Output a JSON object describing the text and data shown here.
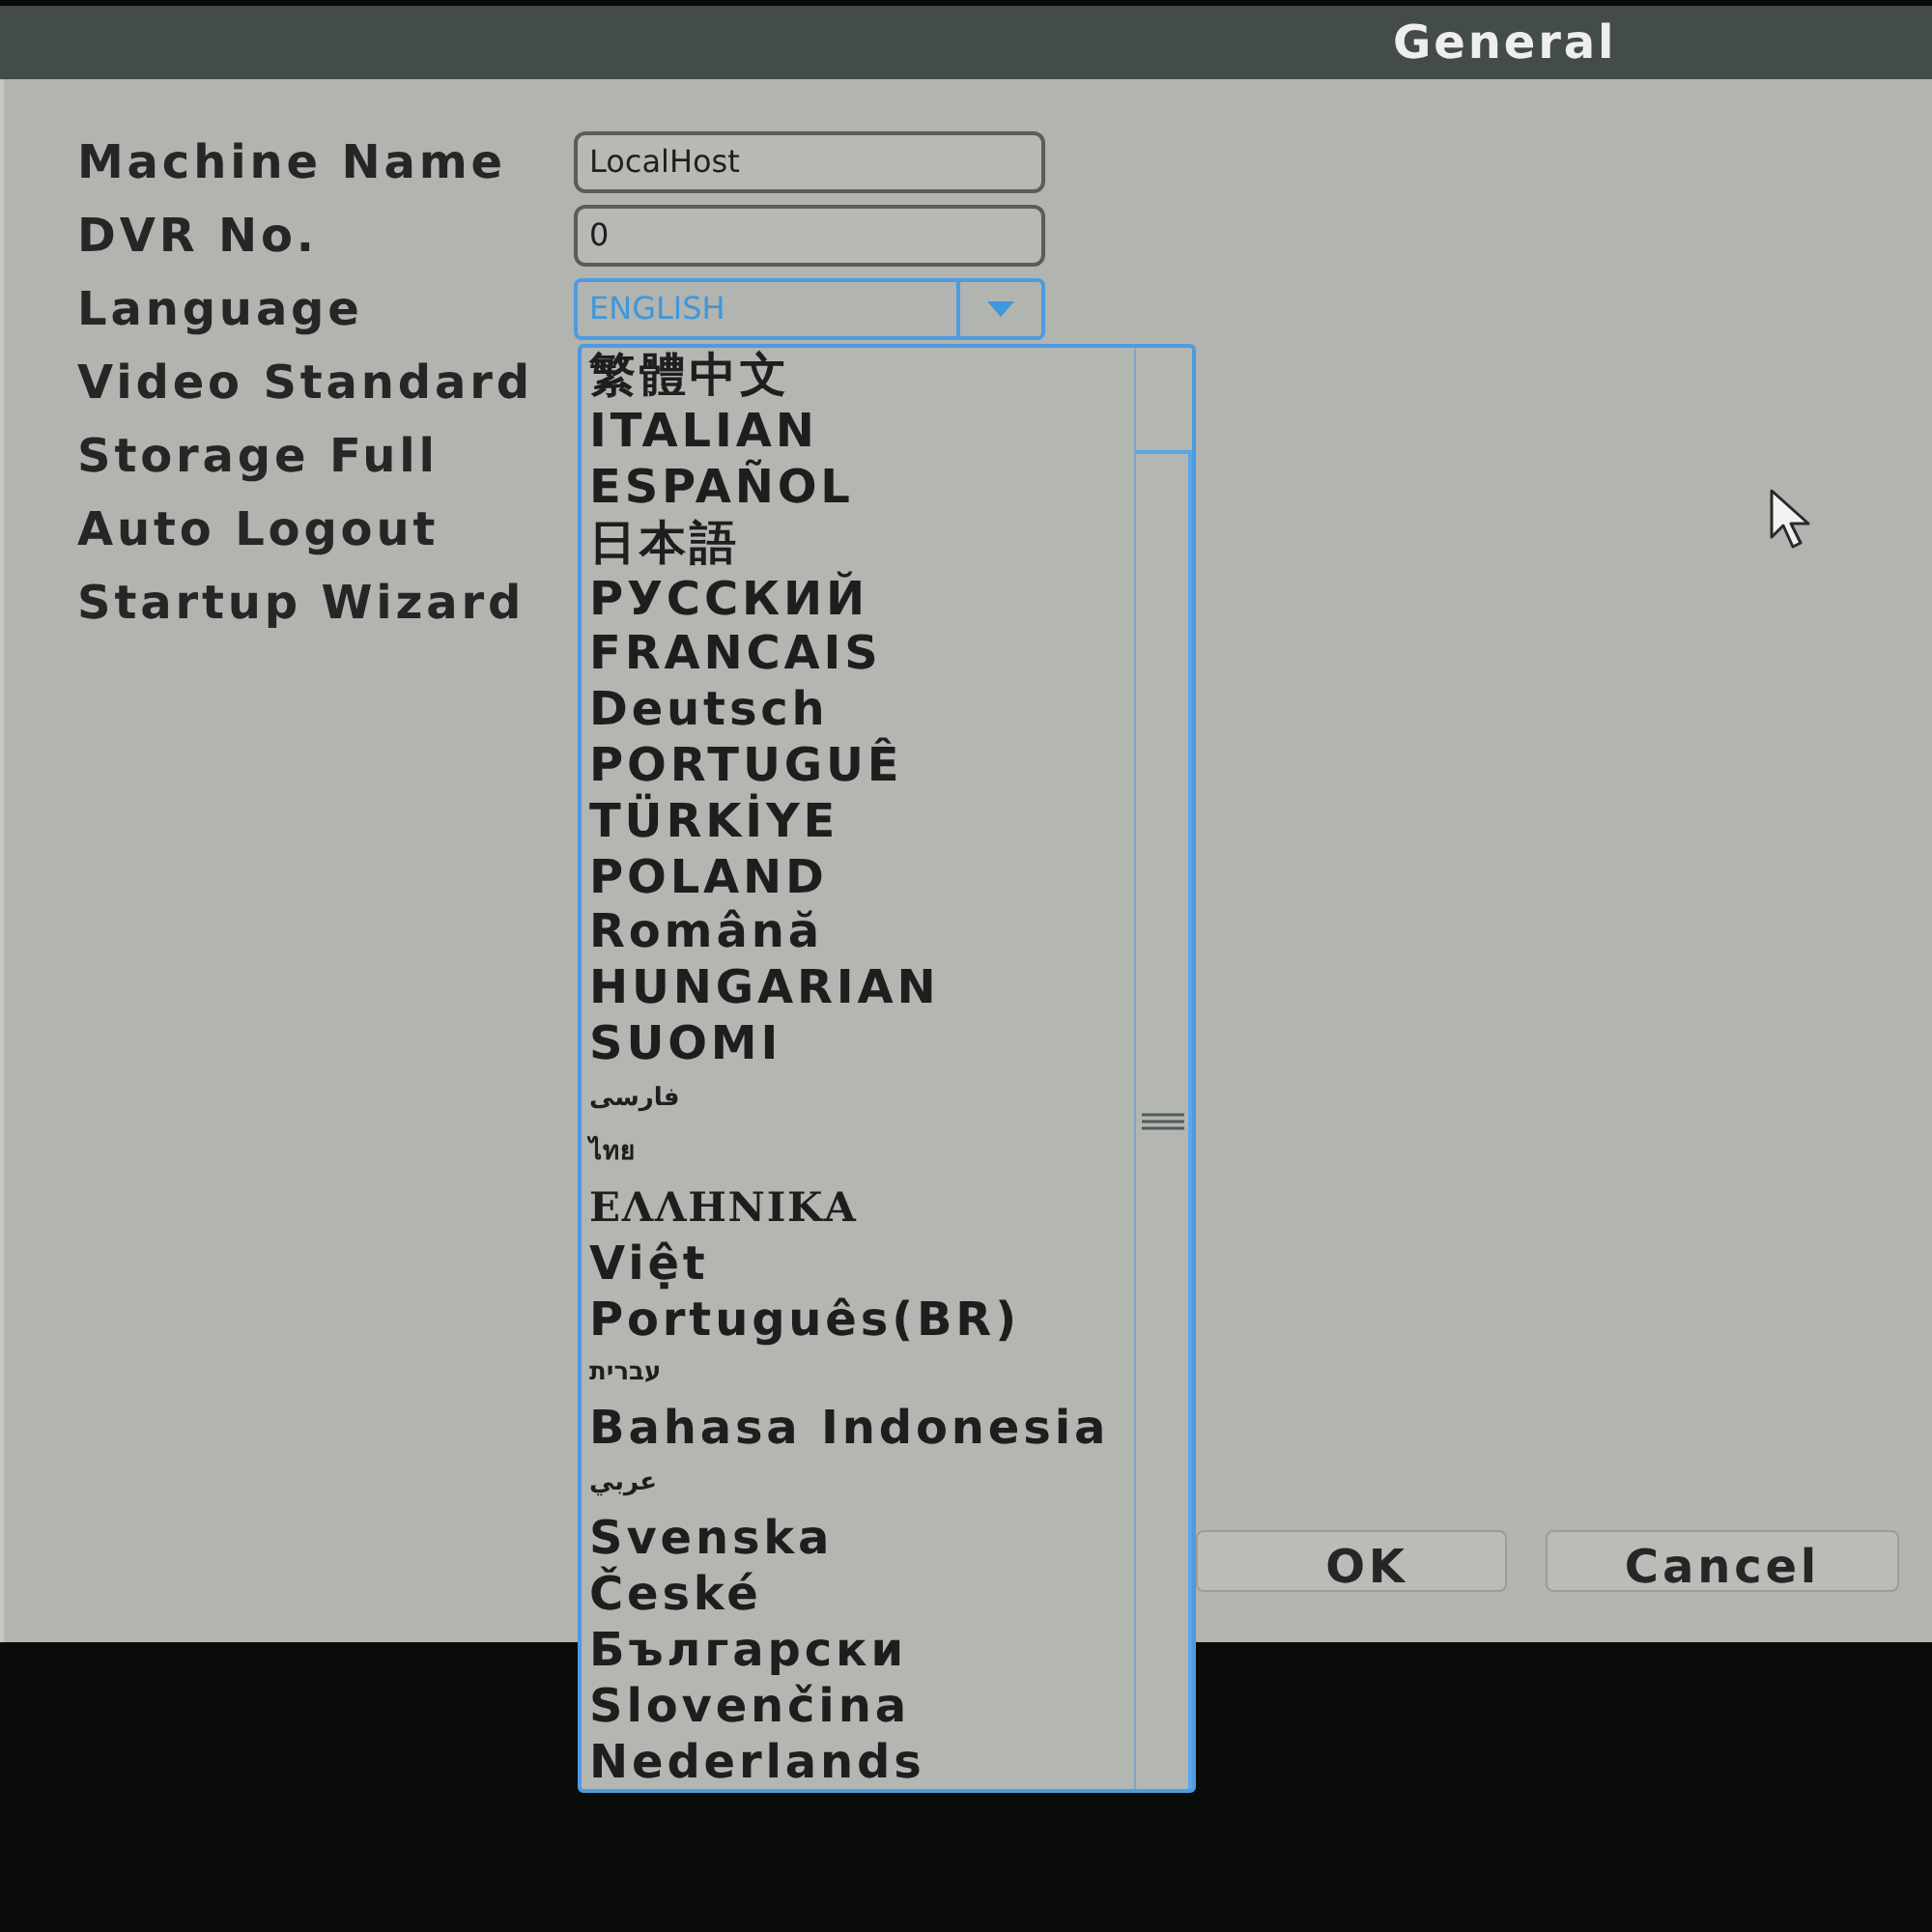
{
  "window": {
    "title": "General"
  },
  "fields": [
    {
      "label": "Machine Name",
      "kind": "text",
      "value": "LocalHost"
    },
    {
      "label": "DVR No.",
      "kind": "text",
      "value": "0"
    },
    {
      "label": "Language",
      "kind": "dropdown",
      "value": "ENGLISH",
      "expanded": true,
      "options": [
        {
          "label": "繁體中文",
          "kind": "sans",
          "selected": false
        },
        {
          "label": "ITALIAN",
          "kind": "sans",
          "selected": false
        },
        {
          "label": "ESPAÑOL",
          "kind": "sans",
          "selected": false
        },
        {
          "label": "日本語",
          "kind": "sans",
          "selected": false
        },
        {
          "label": "РУССКИЙ",
          "kind": "sans",
          "selected": false
        },
        {
          "label": "FRANCAIS",
          "kind": "sans",
          "selected": false
        },
        {
          "label": "Deutsch",
          "kind": "sans",
          "selected": false
        },
        {
          "label": "PORTUGUÊ",
          "kind": "sans",
          "selected": false
        },
        {
          "label": "TÜRKİYE",
          "kind": "sans",
          "selected": false
        },
        {
          "label": "POLAND",
          "kind": "sans",
          "selected": false
        },
        {
          "label": "Română",
          "kind": "sans",
          "selected": false
        },
        {
          "label": "HUNGARIAN",
          "kind": "sans",
          "selected": false
        },
        {
          "label": "SUOMI",
          "kind": "sans",
          "selected": false
        },
        {
          "label": "فارسی",
          "kind": "small",
          "selected": false
        },
        {
          "label": "ไทย",
          "kind": "small",
          "selected": false
        },
        {
          "label": "ΕΛΛΗΝΙΚΑ",
          "kind": "serif",
          "selected": false
        },
        {
          "label": "Việt",
          "kind": "sans",
          "selected": false
        },
        {
          "label": "Português(BR)",
          "kind": "sans",
          "selected": false
        },
        {
          "label": "עברית",
          "kind": "small",
          "selected": false
        },
        {
          "label": "Bahasa Indonesia",
          "kind": "sans",
          "selected": false
        },
        {
          "label": "عربي",
          "kind": "small",
          "selected": false
        },
        {
          "label": "Svenska",
          "kind": "sans",
          "selected": false
        },
        {
          "label": "České",
          "kind": "sans",
          "selected": false
        },
        {
          "label": "Български",
          "kind": "sans",
          "selected": false
        },
        {
          "label": "Slovenčina",
          "kind": "sans",
          "selected": false
        },
        {
          "label": "Nederlands",
          "kind": "sans",
          "selected": false
        }
      ]
    },
    {
      "label": "Video Standard",
      "kind": "label"
    },
    {
      "label": "Storage Full",
      "kind": "label"
    },
    {
      "label": "Auto Logout",
      "kind": "label"
    },
    {
      "label": "Startup Wizard",
      "kind": "label"
    }
  ],
  "buttons": [
    {
      "label": "OK"
    },
    {
      "label": "Cancel"
    }
  ]
}
